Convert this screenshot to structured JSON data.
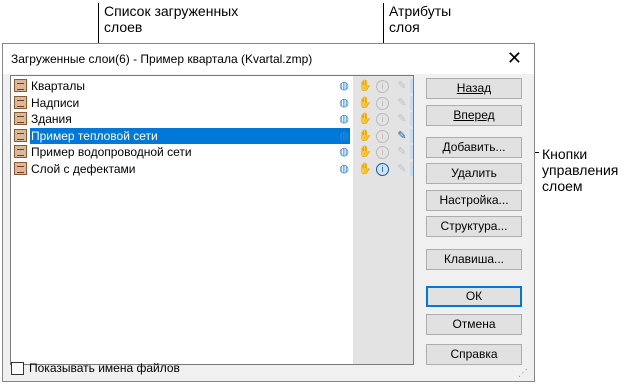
{
  "callouts": {
    "layer_list": [
      "Список загруженных",
      "слоев"
    ],
    "attributes": [
      "Атрибуты",
      "слоя"
    ],
    "buttons": [
      "Кнопки",
      "управления",
      "слоем"
    ]
  },
  "dialog": {
    "title": "Загруженные слои(6) - Пример квартала (Kvartal.zmp)",
    "close_glyph": "✕"
  },
  "layers": [
    {
      "name": "Кварталы",
      "selected": false,
      "info_active": false,
      "edit_active": false
    },
    {
      "name": "Надписи",
      "selected": false,
      "info_active": false,
      "edit_active": false
    },
    {
      "name": "Здания",
      "selected": false,
      "info_active": false,
      "edit_active": false
    },
    {
      "name": "Пример тепловой сети",
      "selected": true,
      "info_active": false,
      "edit_active": true
    },
    {
      "name": "Пример водопроводной сети",
      "selected": false,
      "info_active": false,
      "edit_active": false
    },
    {
      "name": "Слой с дефектами",
      "selected": false,
      "info_active": true,
      "edit_active": false
    }
  ],
  "icons": {
    "layer": "layer-icon",
    "globe": "globe-icon",
    "hand": "hand-icon",
    "info": "info-icon",
    "pencil": "pencil-icon",
    "eye": "eye-icon"
  },
  "buttons": {
    "back": "Назад",
    "forward": "Вперед",
    "add": "Добавить...",
    "remove": "Удалить",
    "settings": "Настройка...",
    "structure": "Структура...",
    "key": "Клавиша...",
    "ok": "ОК",
    "cancel": "Отмена",
    "help": "Справка"
  },
  "show_filenames_label": "Показывать имена файлов",
  "colors": {
    "selection": "#0078d7",
    "eye_bg": "#c6dcf2"
  }
}
